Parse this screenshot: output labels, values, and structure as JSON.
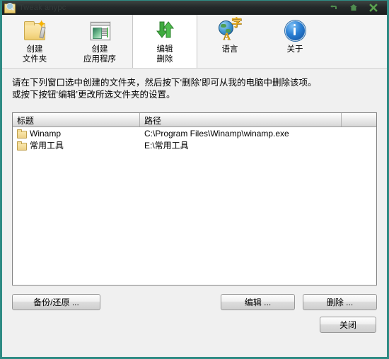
{
  "window": {
    "title": "Tweak anypc",
    "controls": [
      {
        "name": "minimize",
        "glyph": "minimize-icon"
      },
      {
        "name": "maximize",
        "glyph": "maximize-icon"
      },
      {
        "name": "close",
        "glyph": "close-icon"
      }
    ],
    "accent_color": "#2e8b84",
    "titlebar_color": "#24292a",
    "background_color": "#f0f0f0"
  },
  "toolbar": {
    "buttons": [
      {
        "id": "create-folder",
        "label": "创建\n文件夹",
        "icon": "new-folder-icon",
        "active": false
      },
      {
        "id": "create-application",
        "label": "创建\n应用程序",
        "icon": "application-window-icon",
        "active": false
      },
      {
        "id": "edit-delete",
        "label": "编辑\n删除",
        "icon": "up-down-arrows-icon",
        "active": true
      },
      {
        "id": "language",
        "label": "语言",
        "icon": "globe-language-icon",
        "active": false
      },
      {
        "id": "about",
        "label": "关于",
        "icon": "info-circle-icon",
        "active": false
      }
    ]
  },
  "instructions": {
    "line1": "请在下列窗口选中创建的文件夹，然后按下‘删除’即可从我的电脑中删除该项。",
    "line2": "或按下按钮‘编辑’更改所选文件夹的设置。"
  },
  "list": {
    "columns": [
      "标题",
      "路径",
      ""
    ],
    "rows": [
      {
        "title": "Winamp",
        "path": "C:\\Program Files\\Winamp\\winamp.exe",
        "icon": "folder-icon"
      },
      {
        "title": "常用工具",
        "path": "E:\\常用工具",
        "icon": "folder-icon"
      }
    ]
  },
  "footer": {
    "backup_label": "备份/还原 ...",
    "edit_label": "编辑 ...",
    "delete_label": "删除 ...",
    "close_label": "关闭"
  }
}
